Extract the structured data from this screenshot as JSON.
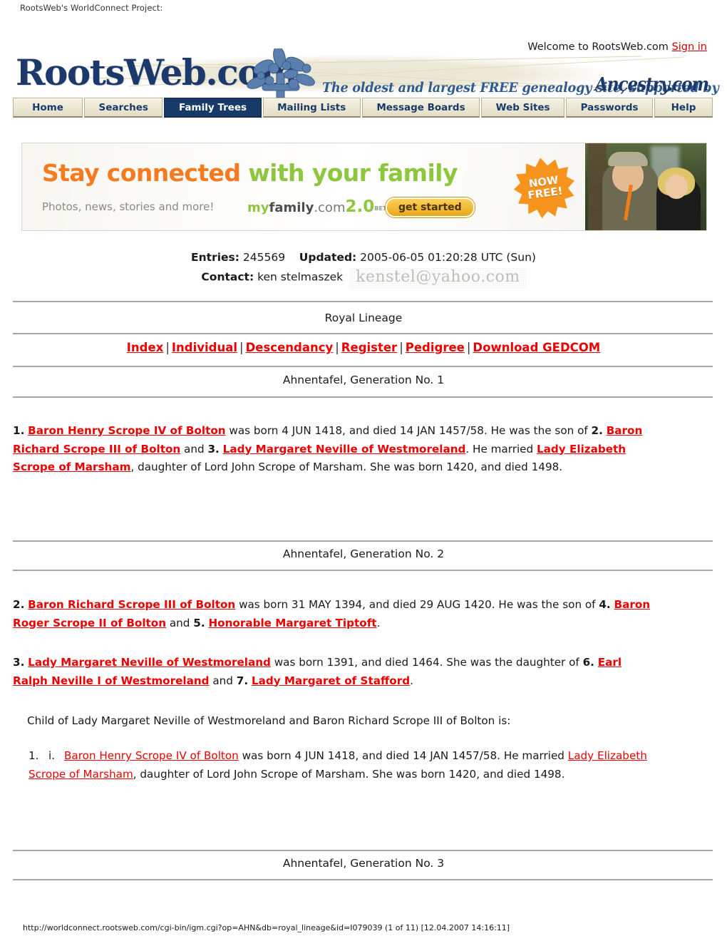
{
  "browser": {
    "page_title": "RootsWeb's WorldConnect Project:"
  },
  "header": {
    "welcome_text": "Welcome to RootsWeb.com",
    "signin_label": "Sign in",
    "logo_text": "RootsWeb.com",
    "tagline": "The oldest and largest FREE genealogy site, supported by",
    "partner_logo": "Ancestry.com",
    "tree_icon": "family-tree-icon"
  },
  "nav": {
    "tabs": [
      {
        "label": "Home",
        "active": false
      },
      {
        "label": "Searches",
        "active": false
      },
      {
        "label": "Family Trees",
        "active": true
      },
      {
        "label": "Mailing Lists",
        "active": false
      },
      {
        "label": "Message Boards",
        "active": false
      },
      {
        "label": "Web Sites",
        "active": false
      },
      {
        "label": "Passwords",
        "active": false
      },
      {
        "label": "Help",
        "active": false
      }
    ]
  },
  "banner": {
    "headline_part1": "Stay connected",
    "headline_part2": " with your family",
    "subtext": "Photos, news, stories and more!",
    "brand_my": "my",
    "brand_family": "family",
    "brand_dotcom": ".com",
    "brand_two": "2.0",
    "brand_beta": "BETA",
    "cta_label": "get started",
    "badge_line1": "NOW",
    "badge_line2": "FREE!",
    "photo_alt": "father-and-son-photo"
  },
  "meta": {
    "entries_label": "Entries:",
    "entries_value": "245569",
    "updated_label": "Updated:",
    "updated_value": "2005-06-05 01:20:28 UTC (Sun)",
    "contact_label": "Contact:",
    "contact_value": "ken stelmaszek",
    "contact_email_image": "kenstel@yahoo.com"
  },
  "db": {
    "title": "Royal Lineage"
  },
  "toolbar": {
    "links": [
      "Index",
      "Individual",
      "Descendancy",
      "Register",
      "Pedigree",
      "Download GEDCOM"
    ],
    "separator": "|"
  },
  "generations": {
    "gen1_heading": "Ahnentafel, Generation No. 1",
    "gen2_heading": "Ahnentafel, Generation No. 2",
    "gen3_heading": "Ahnentafel, Generation No. 3"
  },
  "entries": {
    "e1": {
      "number": "1.",
      "person": "Baron Henry Scrope IV of Bolton",
      "t1": " was born 4 JUN 1418, and died 14 JAN 1457/58. He was the son of ",
      "father_num": "2.",
      "father": "Baron Richard Scrope III of Bolton",
      "t2": " and ",
      "mother_num": "3.",
      "mother": "Lady Margaret Neville of Westmoreland",
      "t3": ". He married ",
      "spouse": "Lady Elizabeth Scrope of Marsham",
      "t4": ", daughter of Lord John Scrope of Marsham. She was born 1420, and died 1498."
    },
    "e2": {
      "number": "2.",
      "person": "Baron Richard Scrope III of Bolton",
      "t1": " was born 31 MAY 1394, and died 29 AUG 1420. He was the son of ",
      "father_num": "4.",
      "father": "Baron Roger Scrope II of Bolton",
      "t2": " and ",
      "mother_num": "5.",
      "mother": "Honorable Margaret Tiptoft",
      "t3": "."
    },
    "e3": {
      "number": "3.",
      "person": "Lady Margaret Neville of Westmoreland",
      "t1": " was born 1391, and died 1464. She was the daughter of ",
      "father_num": "6.",
      "father": "Earl Ralph Neville I of Westmoreland",
      "t2": " and ",
      "mother_num": "7.",
      "mother": "Lady Margaret of Stafford",
      "t3": "."
    },
    "child_intro": "Child of Lady Margaret Neville of Westmoreland and Baron Richard Scrope III of Bolton is:",
    "child1": {
      "marker": "1.",
      "roman": "i.",
      "person": "Baron Henry Scrope IV of Bolton",
      "t1": " was born 4 JUN 1418, and died 14 JAN 1457/58. He married ",
      "spouse": "Lady Elizabeth Scrope of Marsham",
      "t2": ", daughter of Lord John Scrope of Marsham. She was born 1420, and died 1498."
    }
  },
  "footer": {
    "url_line": "http://worldconnect.rootsweb.com/cgi-bin/igm.cgi?op=AHN&db=royal_lineage&id=I079039 (1 of 11) [12.04.2007 14:16:11]"
  },
  "colors": {
    "link_red": "#ee0000",
    "navy": "#1b3a6b",
    "tab_cream": "#e3dec5",
    "orange": "#f47b20",
    "green": "#8dc63f"
  }
}
